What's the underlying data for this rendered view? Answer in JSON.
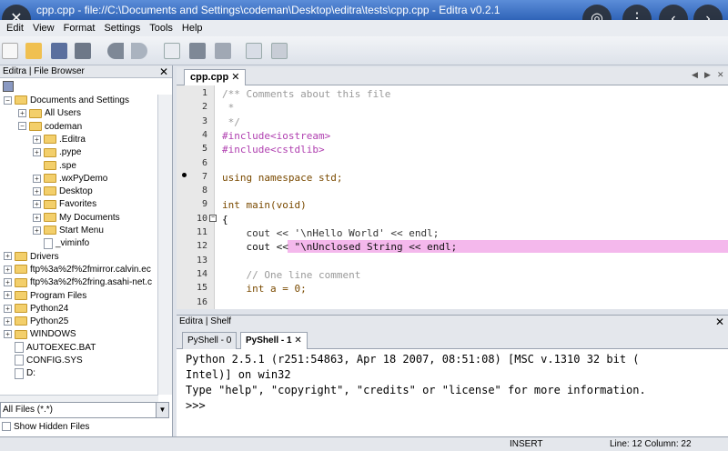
{
  "window": {
    "title": "cpp.cpp - file://C:\\Documents and Settings\\codeman\\Desktop\\editra\\tests\\cpp.cpp - Editra v0.2.1"
  },
  "menu": {
    "items": [
      "Edit",
      "View",
      "Format",
      "Settings",
      "Tools",
      "Help"
    ]
  },
  "file_browser": {
    "title": "Editra | File Browser",
    "tree": [
      {
        "label": "Documents and Settings",
        "level": 0,
        "expander": "−"
      },
      {
        "label": "All Users",
        "level": 1,
        "expander": "+"
      },
      {
        "label": "codeman",
        "level": 1,
        "expander": "−"
      },
      {
        "label": ".Editra",
        "level": 2,
        "expander": "+"
      },
      {
        "label": ".pype",
        "level": 2,
        "expander": "+"
      },
      {
        "label": ".spe",
        "level": 2,
        "expander": ""
      },
      {
        "label": ".wxPyDemo",
        "level": 2,
        "expander": "+"
      },
      {
        "label": "Desktop",
        "level": 2,
        "expander": "+"
      },
      {
        "label": "Favorites",
        "level": 2,
        "expander": "+"
      },
      {
        "label": "My Documents",
        "level": 2,
        "expander": "+"
      },
      {
        "label": "Start Menu",
        "level": 2,
        "expander": "+"
      },
      {
        "label": "_viminfo",
        "level": 2,
        "expander": "",
        "file": true
      },
      {
        "label": "Drivers",
        "level": 0,
        "expander": "+"
      },
      {
        "label": "ftp%3a%2f%2fmirror.calvin.ec",
        "level": 0,
        "expander": "+"
      },
      {
        "label": "ftp%3a%2f%2fring.asahi-net.c",
        "level": 0,
        "expander": "+"
      },
      {
        "label": "Program Files",
        "level": 0,
        "expander": "+"
      },
      {
        "label": "Python24",
        "level": 0,
        "expander": "+"
      },
      {
        "label": "Python25",
        "level": 0,
        "expander": "+"
      },
      {
        "label": "WINDOWS",
        "level": 0,
        "expander": "+"
      },
      {
        "label": "AUTOEXEC.BAT",
        "level": 0,
        "expander": "",
        "file": true
      },
      {
        "label": "CONFIG.SYS",
        "level": 0,
        "expander": "",
        "file": true
      },
      {
        "label": "D:",
        "level": 0,
        "expander": "",
        "file": true
      }
    ],
    "filter": "All Files (*.*)",
    "show_hidden": "Show Hidden Files"
  },
  "editor": {
    "tab": "cpp.cpp",
    "lines": [
      {
        "n": "1",
        "code": "/** Comments about this file",
        "cls": "cmt"
      },
      {
        "n": "2",
        "code": " *",
        "cls": "cmt"
      },
      {
        "n": "3",
        "code": " */",
        "cls": "cmt"
      },
      {
        "n": "4",
        "code": "#include<iostream>",
        "cls": "pp"
      },
      {
        "n": "5",
        "code": "#include<cstdlib>",
        "cls": "pp"
      },
      {
        "n": "6",
        "code": "",
        "cls": ""
      },
      {
        "n": "7",
        "code": "using namespace std;",
        "cls": "mix1"
      },
      {
        "n": "8",
        "code": "",
        "cls": ""
      },
      {
        "n": "9",
        "code": "int main(void)",
        "cls": "mix2"
      },
      {
        "n": "10",
        "code": "{",
        "cls": ""
      },
      {
        "n": "11",
        "code": "    cout << '\\nHello World' << endl;",
        "cls": "mix3"
      },
      {
        "n": "12",
        "code": "    cout << \"\\nUnclosed String << endl;",
        "cls": "mix4"
      },
      {
        "n": "13",
        "code": "",
        "cls": ""
      },
      {
        "n": "14",
        "code": "    // One line comment",
        "cls": "cmt"
      },
      {
        "n": "15",
        "code": "    int a = 0;",
        "cls": "mix5"
      },
      {
        "n": "16",
        "code": "",
        "cls": ""
      }
    ]
  },
  "shelf": {
    "title": "Editra | Shelf",
    "tabs": [
      "PyShell - 0",
      "PyShell - 1"
    ],
    "output": "Python 2.5.1 (r251:54863, Apr 18 2007, 08:51:08) [MSC v.1310 32 bit (\nIntel)] on win32\nType \"help\", \"copyright\", \"credits\" or \"license\" for more information.\n>>>"
  },
  "status": {
    "mode": "INSERT",
    "position": "Line: 12  Column: 22"
  }
}
